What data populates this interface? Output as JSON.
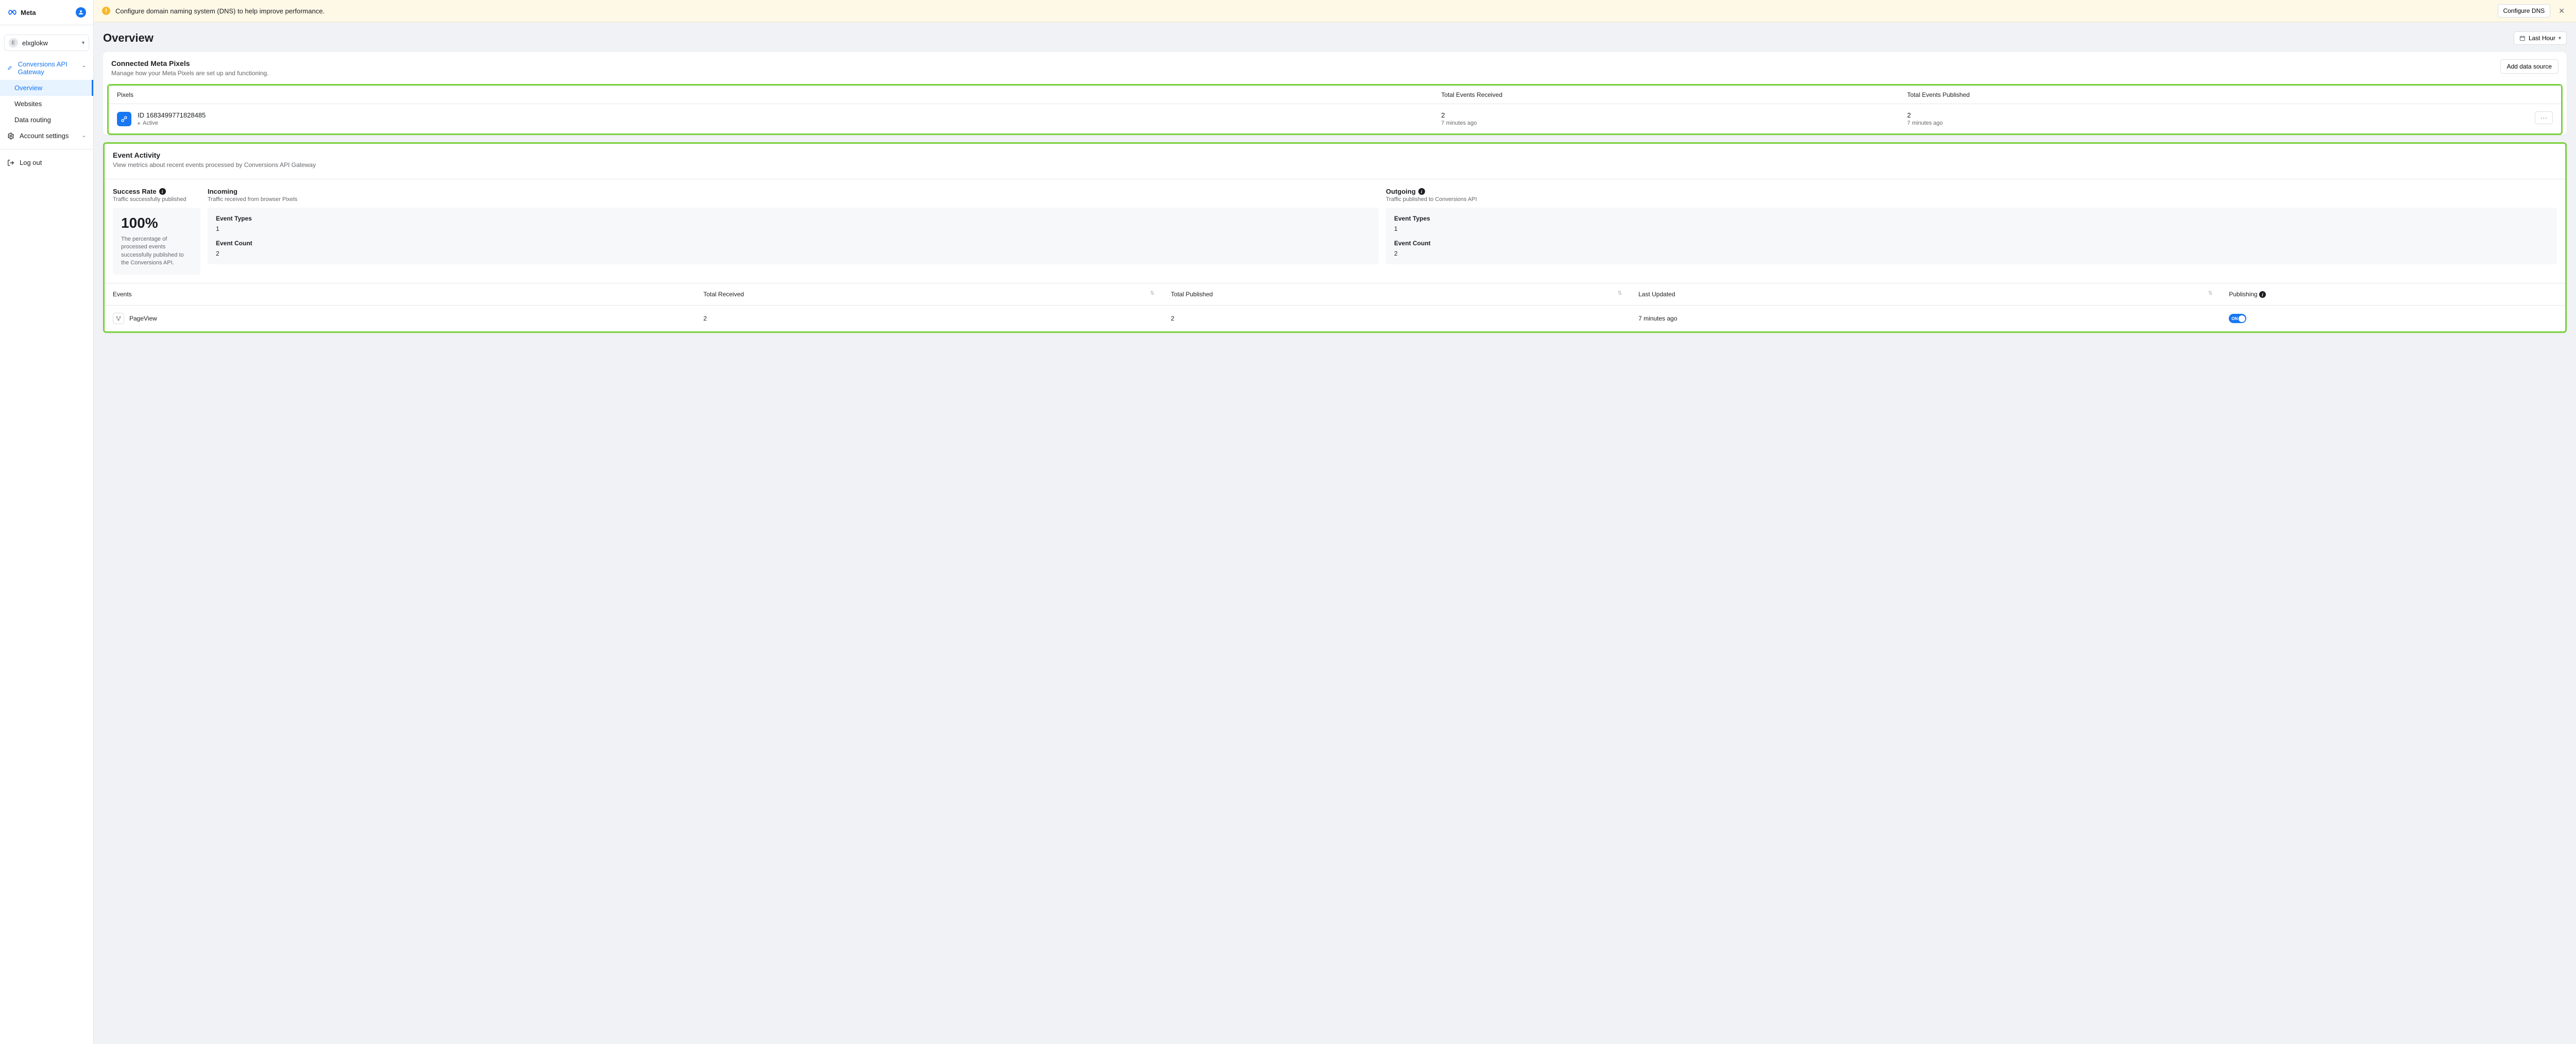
{
  "brand": "Meta",
  "sidebar": {
    "user": "elxglokw",
    "topItem": "Conversions API Gateway",
    "items": [
      "Overview",
      "Websites",
      "Data routing"
    ],
    "settings": "Account settings",
    "logout": "Log out"
  },
  "banner": {
    "text": "Configure domain naming system (DNS) to help improve performance.",
    "button": "Configure DNS"
  },
  "page": {
    "title": "Overview",
    "range": "Last Hour"
  },
  "pixelsCard": {
    "title": "Connected Meta Pixels",
    "subtitle": "Manage how your Meta Pixels are set up and functioning.",
    "addBtn": "Add data source",
    "columns": {
      "pixels": "Pixels",
      "received": "Total Events Received",
      "published": "Total Events Published"
    },
    "row": {
      "id": "ID 1683499771828485",
      "status": "Active",
      "received": "2",
      "receivedTime": "7 minutes ago",
      "published": "2",
      "publishedTime": "7 minutes ago"
    }
  },
  "activityCard": {
    "title": "Event Activity",
    "subtitle": "View metrics about recent events processed by Conversions API Gateway",
    "success": {
      "label": "Success Rate",
      "desc": "Traffic successfully published",
      "value": "100%",
      "box": "The percentage of processed events successfully published to the Conversions API."
    },
    "incoming": {
      "label": "Incoming",
      "desc": "Traffic received from browser Pixels",
      "types": "Event Types",
      "typesVal": "1",
      "count": "Event Count",
      "countVal": "2"
    },
    "outgoing": {
      "label": "Outgoing",
      "desc": "Traffic published to Conversions API",
      "types": "Event Types",
      "typesVal": "1",
      "count": "Event Count",
      "countVal": "2"
    },
    "eventsCols": {
      "events": "Events",
      "received": "Total Received",
      "published": "Total Published",
      "updated": "Last Updated",
      "publishing": "Publishing"
    },
    "eventsRow": {
      "name": "PageView",
      "received": "2",
      "published": "2",
      "updated": "7 minutes ago",
      "toggle": "ON"
    }
  }
}
